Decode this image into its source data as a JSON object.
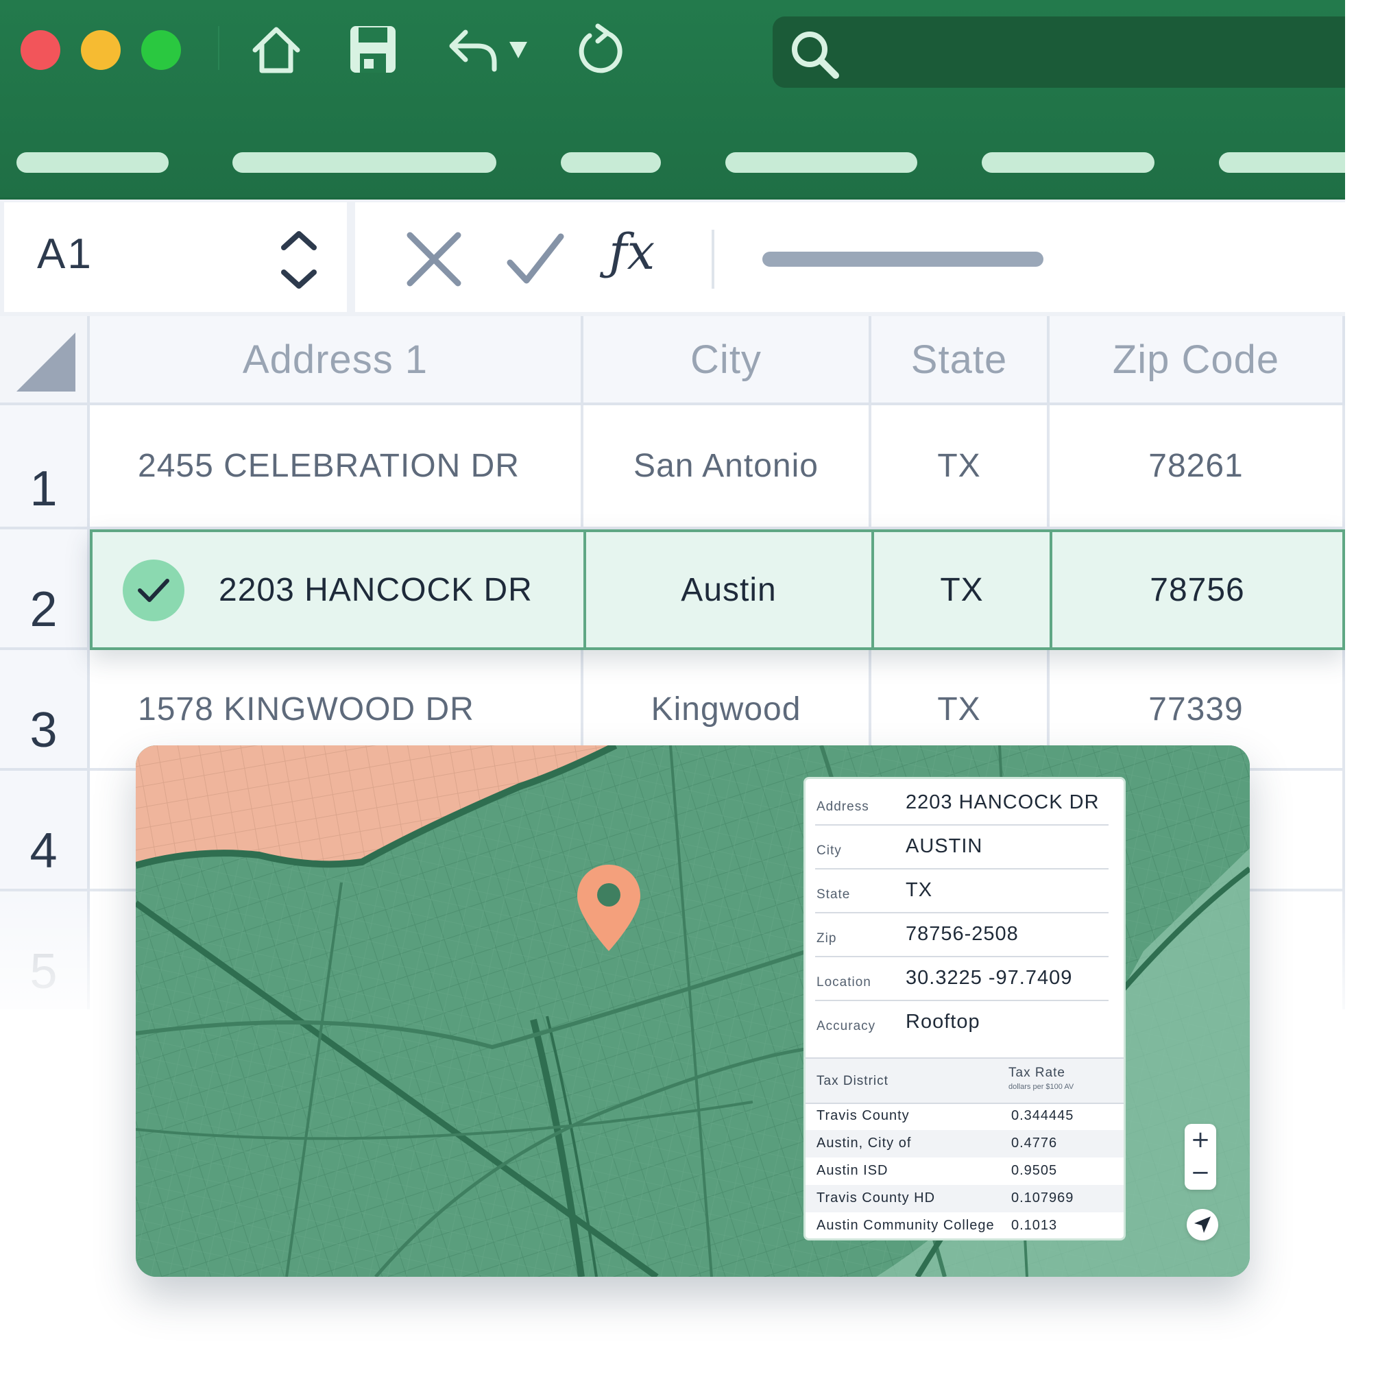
{
  "toolbar": {
    "search": {
      "placeholder": "",
      "icon": "search-icon"
    },
    "icons": [
      "home-icon",
      "save-icon",
      "undo-icon",
      "dropdown-caret-icon",
      "refresh-icon"
    ],
    "colors": {
      "toolbar_bg": "#217346",
      "accent": "#5fa784"
    }
  },
  "formula_bar": {
    "cell_ref": "A1",
    "fx_label": "ƒx"
  },
  "grid": {
    "columns": [
      "Address 1",
      "City",
      "State",
      "Zip Code"
    ],
    "row_numbers": [
      "1",
      "2",
      "3",
      "4",
      "5"
    ],
    "rows": [
      {
        "address": "2455 CELEBRATION DR",
        "city": "San Antonio",
        "state": "TX",
        "zip": "78261"
      },
      {
        "address": "2203 HANCOCK DR",
        "city": "Austin",
        "state": "TX",
        "zip": "78756",
        "selected": true,
        "verified": true
      },
      {
        "address": "1578 KINGWOOD DR",
        "city": "Kingwood",
        "state": "TX",
        "zip": "77339"
      }
    ]
  },
  "map_popup": {
    "fields": [
      {
        "key": "Address",
        "value": "2203 HANCOCK DR"
      },
      {
        "key": "City",
        "value": "AUSTIN"
      },
      {
        "key": "State",
        "value": "TX"
      },
      {
        "key": "Zip",
        "value": "78756-2508"
      },
      {
        "key": "Location",
        "value": "30.3225 -97.7409"
      },
      {
        "key": "Accuracy",
        "value": "Rooftop"
      }
    ],
    "tax_header": {
      "district": "Tax District",
      "rate": "Tax Rate",
      "rate_unit": "dollars per $100 AV"
    },
    "tax_rows": [
      {
        "name": "Travis County",
        "rate": "0.344445"
      },
      {
        "name": "Austin, City of",
        "rate": "0.4776"
      },
      {
        "name": "Austin ISD",
        "rate": "0.9505"
      },
      {
        "name": "Travis County HD",
        "rate": "0.107969"
      },
      {
        "name": "Austin Community College",
        "rate": "0.1013"
      }
    ]
  },
  "map_controls": {
    "zoom_in": "+",
    "zoom_out": "−"
  }
}
